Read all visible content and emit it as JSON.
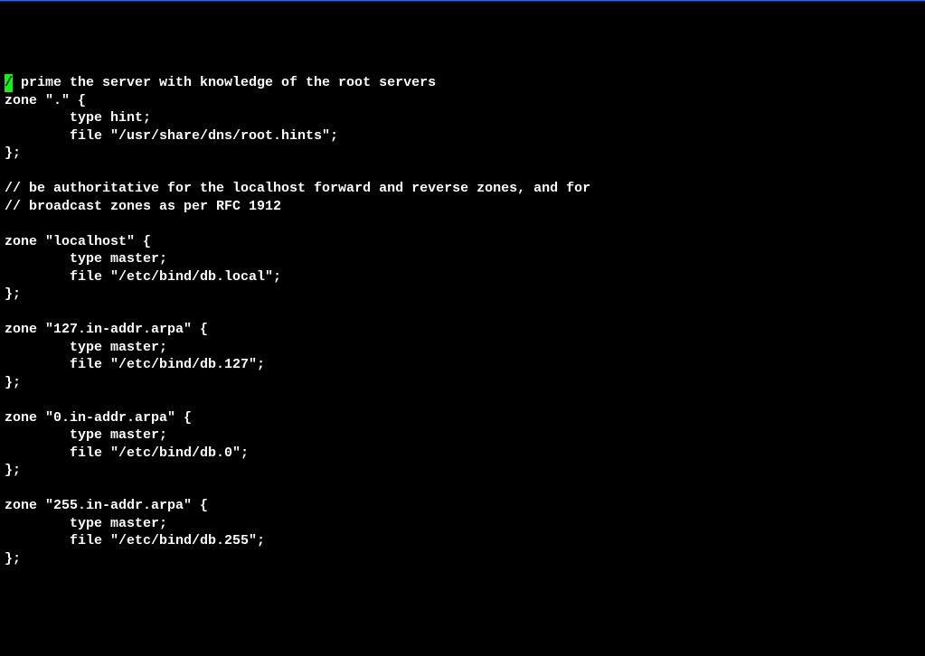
{
  "terminal": {
    "cursor_char": "/",
    "lines": [
      "/ prime the server with knowledge of the root servers",
      "zone \".\" {",
      "        type hint;",
      "        file \"/usr/share/dns/root.hints\";",
      "};",
      "",
      "// be authoritative for the localhost forward and reverse zones, and for",
      "// broadcast zones as per RFC 1912",
      "",
      "zone \"localhost\" {",
      "        type master;",
      "        file \"/etc/bind/db.local\";",
      "};",
      "",
      "zone \"127.in-addr.arpa\" {",
      "        type master;",
      "        file \"/etc/bind/db.127\";",
      "};",
      "",
      "zone \"0.in-addr.arpa\" {",
      "        type master;",
      "        file \"/etc/bind/db.0\";",
      "};",
      "",
      "zone \"255.in-addr.arpa\" {",
      "        type master;",
      "        file \"/etc/bind/db.255\";",
      "};"
    ]
  }
}
